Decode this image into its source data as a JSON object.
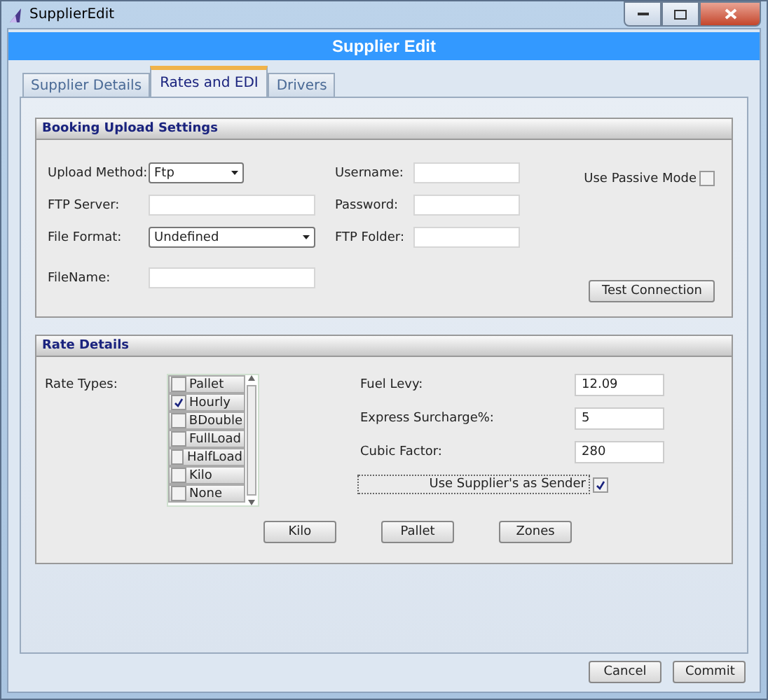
{
  "window": {
    "title": "SupplierEdit"
  },
  "header": {
    "title": "Supplier Edit"
  },
  "tabs": [
    {
      "label": "Supplier Details",
      "selected": false
    },
    {
      "label": "Rates and EDI",
      "selected": true
    },
    {
      "label": "Drivers",
      "selected": false
    }
  ],
  "booking": {
    "title": "Booking Upload Settings",
    "left_fields": [
      {
        "label": "Upload Method:",
        "kind": "dropdown",
        "value": "Ftp"
      },
      {
        "label": "FTP Server:",
        "kind": "text"
      },
      {
        "label": "File Format:",
        "kind": "dropdown",
        "value": "Undefined"
      },
      {
        "label": "FileName:",
        "kind": "text"
      }
    ],
    "right_fields": [
      {
        "label": "Username:",
        "kind": "text"
      },
      {
        "label": "Password:",
        "kind": "text"
      },
      {
        "label": "FTP Folder:",
        "kind": "text"
      }
    ],
    "passive_mode": {
      "label": "Use Passive Mode",
      "checked": false
    },
    "test_button": "Test Connection"
  },
  "rate_details": {
    "title": "Rate Details",
    "rate_types": {
      "label": "Rate Types:",
      "items": [
        {
          "label": "Pallet",
          "checked": false
        },
        {
          "label": "Hourly",
          "checked": true
        },
        {
          "label": "BDouble",
          "checked": false
        },
        {
          "label": "FullLoad",
          "checked": false
        },
        {
          "label": "HalfLoad",
          "checked": false
        },
        {
          "label": "Kilo",
          "checked": false
        },
        {
          "label": "None",
          "checked": false
        }
      ]
    },
    "fields": [
      {
        "label": "Fuel Levy:",
        "value": "12.09"
      },
      {
        "label": "Express Surcharge%:",
        "value": "5"
      },
      {
        "label": "Cubic Factor:",
        "value": "280"
      }
    ],
    "use_sender": {
      "label": "Use Supplier's as Sender",
      "checked": true
    },
    "buttons": [
      "Kilo",
      "Pallet",
      "Zones"
    ]
  },
  "buttons": [
    "Cancel",
    "Commit"
  ]
}
